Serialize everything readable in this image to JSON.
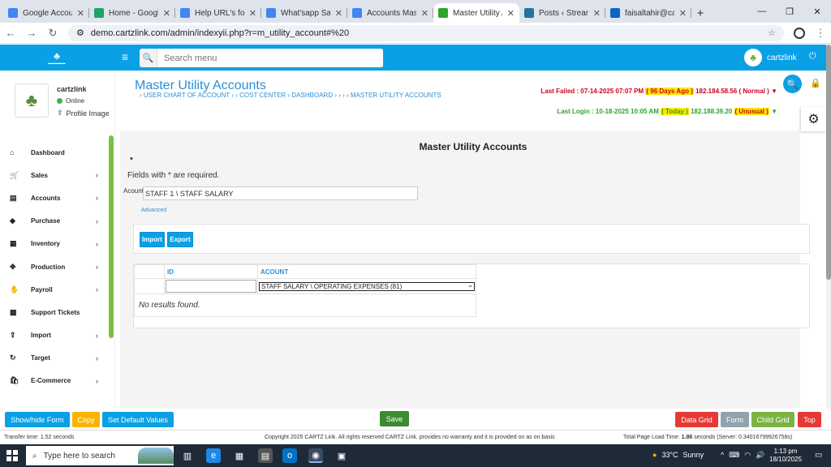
{
  "browser": {
    "tabs": [
      {
        "title": "Google Accounts",
        "color": "#4285f4",
        "active": false
      },
      {
        "title": "Home - Google Dr",
        "color": "#1fa463",
        "active": false
      },
      {
        "title": "Help URL's for ER",
        "color": "#4285f4",
        "active": false
      },
      {
        "title": "What'sapp Sales M",
        "color": "#4285f4",
        "active": false
      },
      {
        "title": "Accounts Master",
        "color": "#4285f4",
        "active": false
      },
      {
        "title": "Master Utility Acc",
        "color": "#2aa52a",
        "active": true
      },
      {
        "title": "Posts ‹ Streamline",
        "color": "#21759b",
        "active": false
      },
      {
        "title": "faisaltahir@cartzl",
        "color": "#0a66c2",
        "active": false
      }
    ],
    "new_tab": "+",
    "url": "demo.cartzlink.com/admin/indexyii.php?r=m_utility_account#%20"
  },
  "header": {
    "search_placeholder": "Search menu",
    "username": "cartzlink",
    "accent": "#0aa0e6"
  },
  "sidebar": {
    "profile_name": "cartzlink",
    "status": "Online",
    "profile_image_link": "Profile Image",
    "items": [
      {
        "label": "Dashboard",
        "icon": "home-icon",
        "glyph": "⌂",
        "chevron": false
      },
      {
        "label": "Sales",
        "icon": "cart-icon",
        "glyph": "🛒",
        "chevron": true
      },
      {
        "label": "Accounts",
        "icon": "bank-icon",
        "glyph": "▤",
        "chevron": true
      },
      {
        "label": "Purchase",
        "icon": "tag-icon",
        "glyph": "◆",
        "chevron": true
      },
      {
        "label": "Inventory",
        "icon": "grid-icon",
        "glyph": "▦",
        "chevron": true
      },
      {
        "label": "Production",
        "icon": "move-icon",
        "glyph": "✥",
        "chevron": true
      },
      {
        "label": "Payroll",
        "icon": "hand-icon",
        "glyph": "✋",
        "chevron": true
      },
      {
        "label": "Support Tickets",
        "icon": "tickets-icon",
        "glyph": "▩",
        "chevron": false
      },
      {
        "label": "Import",
        "icon": "upload-icon",
        "glyph": "⇪",
        "chevron": true
      },
      {
        "label": "Target",
        "icon": "refresh-icon",
        "glyph": "↻",
        "chevron": true
      },
      {
        "label": "E-Commerce",
        "icon": "shopping-icon",
        "glyph": "🛍",
        "chevron": true
      }
    ]
  },
  "page": {
    "title": "Master Utility Accounts",
    "breadcrumb": "› USER CHART OF ACCOUNT  › › COST CENTER  › DASHBOARD  ›  ›  ›  › MASTER UTILITY ACCOUNTS",
    "last_failed": {
      "label": "Last Failed : 07-14-2025 07:07 PM",
      "ago": "( 96 Days Ago )",
      "ip": "182.184.58.56",
      "flag": "( Normal )"
    },
    "last_login": {
      "label": "Last Login : 10-18-2025 10:05 AM",
      "ago": "( Today )",
      "ip": "182.188.39.20",
      "flag": "( Unusual )"
    }
  },
  "form": {
    "heading": "Master Utility Accounts",
    "bullet": "•",
    "required_note": "Fields with * are required.",
    "account_label": "Acount",
    "account_value": "STAFF 1 \\ STAFF SALARY",
    "advanced_link": "Advanced",
    "import_label": "Import",
    "export_label": "Export"
  },
  "grid": {
    "columns": [
      "ID",
      "ACOUNT"
    ],
    "filter_select": "STAFF SALARY \\ OPERATING EXPENSES (81)",
    "empty_text": "No results found."
  },
  "bottom_buttons": {
    "show_hide_form": "Show/hide Form",
    "copy": "Copy",
    "set_default": "Set Default Values",
    "save": "Save",
    "data_grid": "Data Grid",
    "form": "Form",
    "child_grid": "Child Grid",
    "top": "Top"
  },
  "footer": {
    "transfer_time": "Transfer time: 1.52 seconds",
    "copyright": "Copyright 2025 CARTZ Link. All rights reserved CARTZ Link. provides no warranty and it is provided on as on basis",
    "load_time_prefix": "Total Page Load Time: ",
    "load_time_value": "1.86",
    "load_time_suffix": " seconds (Server: 0.34016799926758s)"
  },
  "taskbar": {
    "search_placeholder": "Type here to search",
    "temperature": "33°C",
    "weather": "Sunny",
    "time": "1:13 pm",
    "date": "18/10/2025"
  }
}
